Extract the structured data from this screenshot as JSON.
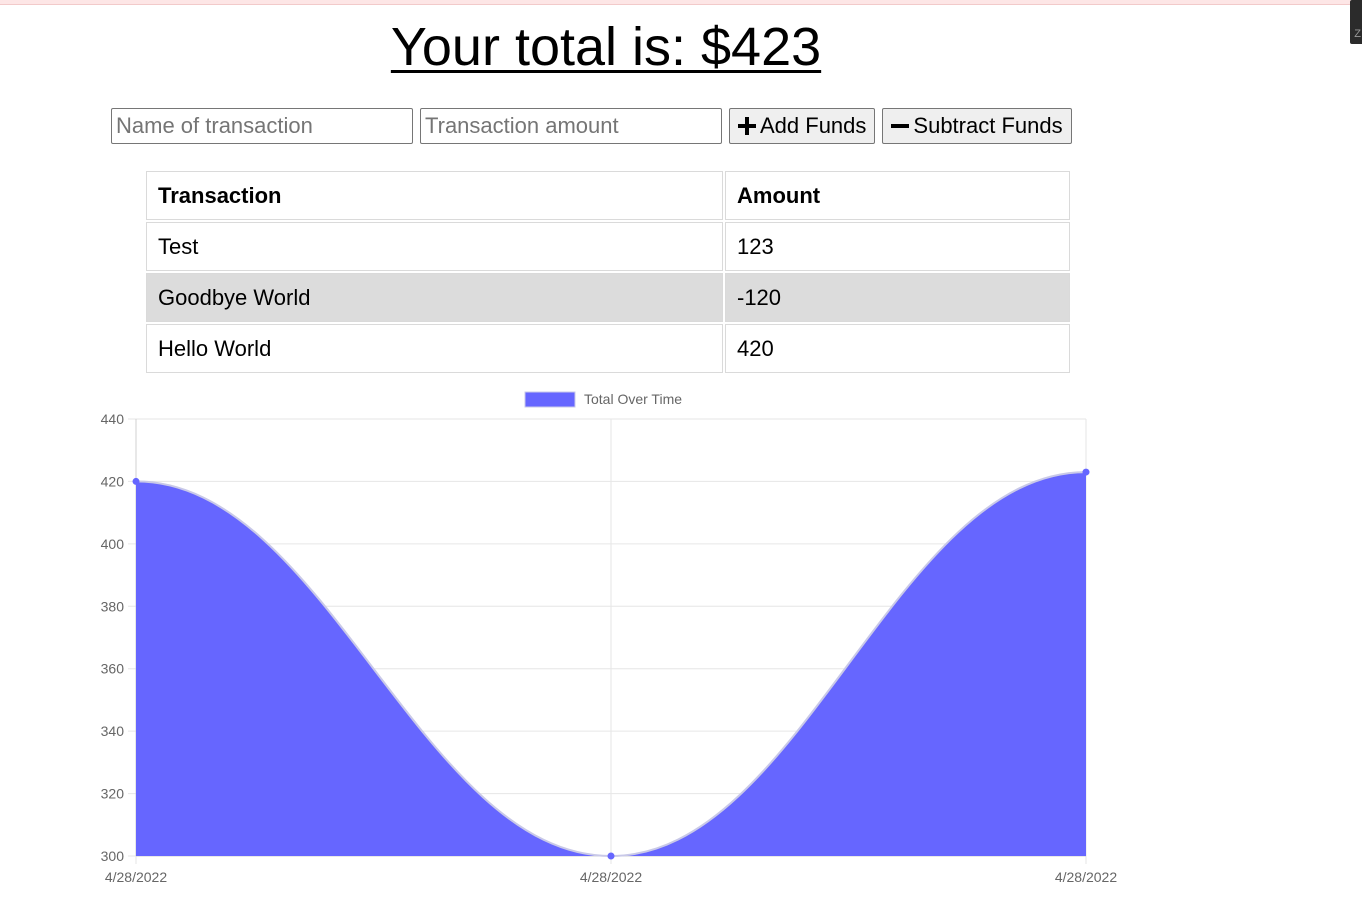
{
  "header": {
    "title": "Your total is: $423"
  },
  "form": {
    "name_placeholder": "Name of transaction",
    "amount_placeholder": "Transaction amount",
    "add_label": "Add Funds",
    "subtract_label": "Subtract Funds"
  },
  "table": {
    "headers": [
      "Transaction",
      "Amount"
    ],
    "rows": [
      [
        "Test",
        "123"
      ],
      [
        "Goodbye World",
        "-120"
      ],
      [
        "Hello World",
        "420"
      ]
    ]
  },
  "chart_data": {
    "type": "area",
    "categories": [
      "4/28/2022",
      "4/28/2022",
      "4/28/2022"
    ],
    "series": [
      {
        "name": "Total Over Time",
        "values": [
          420,
          300,
          423
        ],
        "color": "#6666ff"
      }
    ],
    "ylim": [
      300,
      440
    ],
    "yticks": [
      300,
      320,
      340,
      360,
      380,
      400,
      420,
      440
    ],
    "legend": "top-center",
    "grid": true,
    "smooth": true
  },
  "colors": {
    "series_fill": "#6666ff",
    "row_alt": "#dcdcdc"
  },
  "icons": {
    "add": "plus-icon",
    "subtract": "minus-icon"
  }
}
